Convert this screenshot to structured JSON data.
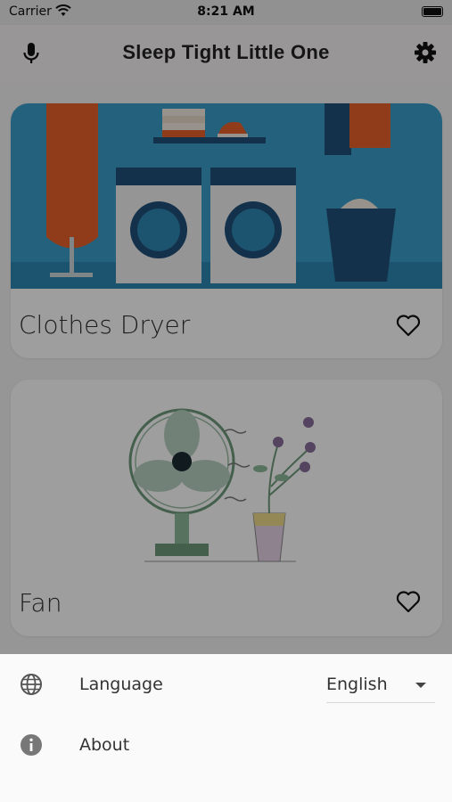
{
  "status_bar": {
    "carrier": "Carrier",
    "time": "8:21 AM"
  },
  "app_bar": {
    "title": "Sleep Tight Little One"
  },
  "cards": [
    {
      "title": "Clothes Dryer",
      "icon": "heart-outline-icon"
    },
    {
      "title": "Fan",
      "icon": "heart-outline-icon"
    }
  ],
  "settings_sheet": {
    "language_label": "Language",
    "language_value": "English",
    "about_label": "About"
  },
  "colors": {
    "overlay": "#000000",
    "sheet": "#fafafa",
    "laundry_bg": "#3a9dc8"
  }
}
